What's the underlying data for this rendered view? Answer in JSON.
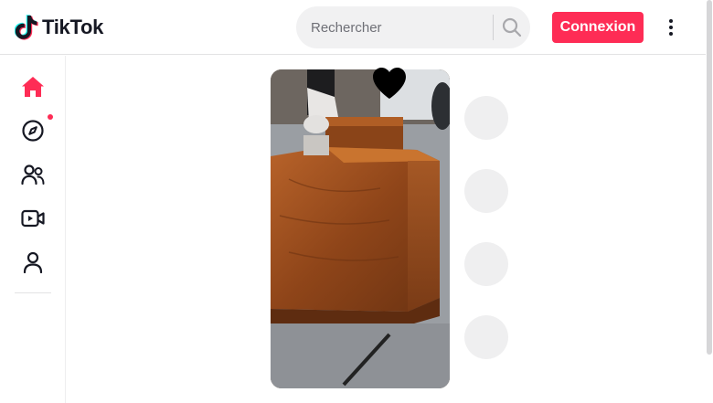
{
  "brand": {
    "logo_text": "TikTok"
  },
  "search": {
    "placeholder": "Rechercher"
  },
  "header": {
    "login_label": "Connexion"
  },
  "sidebar": {
    "items": [
      {
        "name": "home",
        "icon": "home-icon",
        "active": true
      },
      {
        "name": "explore",
        "icon": "compass-icon",
        "has_notification": true
      },
      {
        "name": "following",
        "icon": "users-icon"
      },
      {
        "name": "live",
        "icon": "live-video-icon"
      },
      {
        "name": "profile",
        "icon": "user-icon"
      }
    ]
  },
  "colors": {
    "accent": "#fe2c55",
    "text": "#161823"
  }
}
